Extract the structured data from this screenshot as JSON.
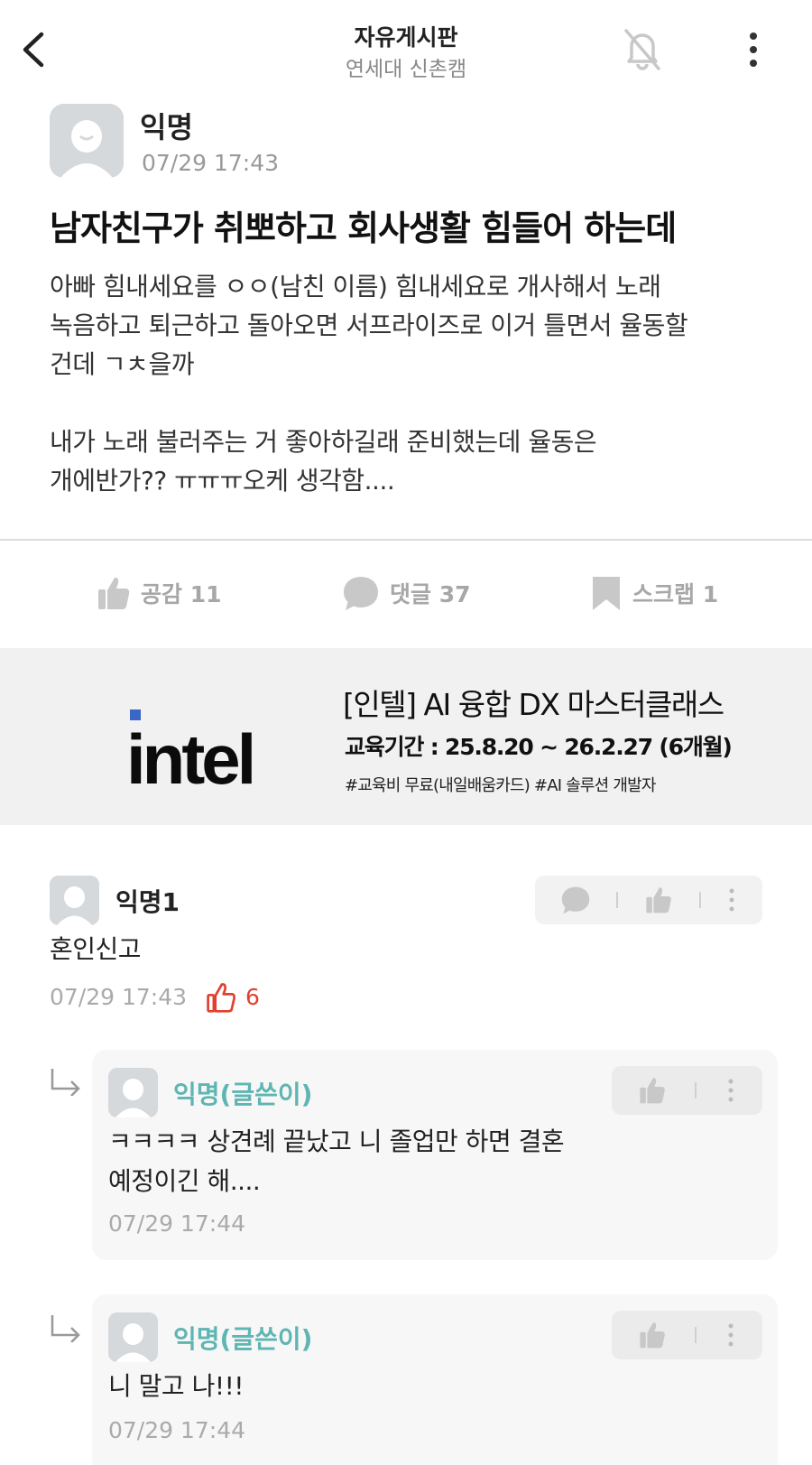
{
  "header": {
    "title": "자유게시판",
    "subtitle": "연세대 신촌캠"
  },
  "post": {
    "author": "익명",
    "time": "07/29 17:43",
    "title": "남자친구가 취뽀하고 회사생활 힘들어 하는데",
    "body": "아빠 힘내세요를 ㅇㅇ(남친 이름) 힘내세요로 개사해서 노래\n녹음하고 퇴근하고 돌아오면 서프라이즈로 이거 틀면서 율동할\n건데 ㄱㅊ을까\n\n내가 노래 불러주는 거 좋아하길래 준비했는데 율동은\n개에반가?? ㅠㅠㅠ오케 생각함....",
    "actions": {
      "like_label": "공감 11",
      "comment_label": "댓글 37",
      "scrap_label": "스크랩 1"
    }
  },
  "ad": {
    "brand": "intel",
    "title": "[인텔] AI 융합 DX 마스터클래스",
    "period": "교육기간 : 25.8.20 ~ 26.2.27 (6개월)",
    "tags": "#교육비 무료(내일배움카드)  #AI 솔루션 개발자"
  },
  "comments": [
    {
      "author": "익명1",
      "text": "혼인신고",
      "time": "07/29 17:43",
      "likes": "6"
    }
  ],
  "replies": [
    {
      "author": "익명(글쓴이)",
      "text": "ㅋㅋㅋㅋ 상견례 끝났고 니 졸업만 하면 결혼\n예정이긴 해....",
      "time": "07/29 17:44"
    },
    {
      "author": "익명(글쓴이)",
      "text": "니 말고 나!!!",
      "time": "07/29 17:44"
    }
  ],
  "colors": {
    "writer_accent": "#5fb5b2",
    "like_red": "#e2402f",
    "muted": "#a7a7a7",
    "ad_background": "#f1f1f1"
  },
  "icons": [
    "back-arrow-icon",
    "bell-off-icon",
    "more-vertical-icon",
    "thumbs-up-icon",
    "speech-bubble-icon",
    "bookmark-icon",
    "reply-arrow-icon",
    "avatar-icon"
  ]
}
